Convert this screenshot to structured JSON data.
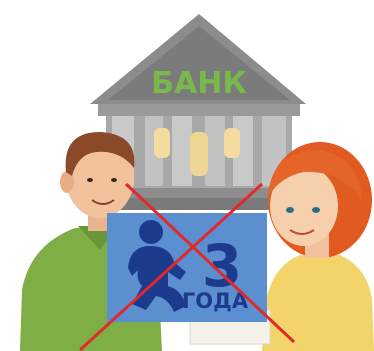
{
  "bank": {
    "sign_text": "БАНК",
    "roof_color": "#8c8c8c",
    "wall_color": "#a8a8a8",
    "sign_text_color": "#79b84a"
  },
  "badge": {
    "number": "3",
    "caption": "ГОДА",
    "background_color": "#5b8fd0",
    "foreground_color": "#1d3b8c"
  },
  "cross_color": "#e3282c",
  "people": {
    "man_shirt_color": "#7fae46",
    "woman_top_color": "#f2d46b",
    "woman_hair_color": "#e15a1f"
  }
}
